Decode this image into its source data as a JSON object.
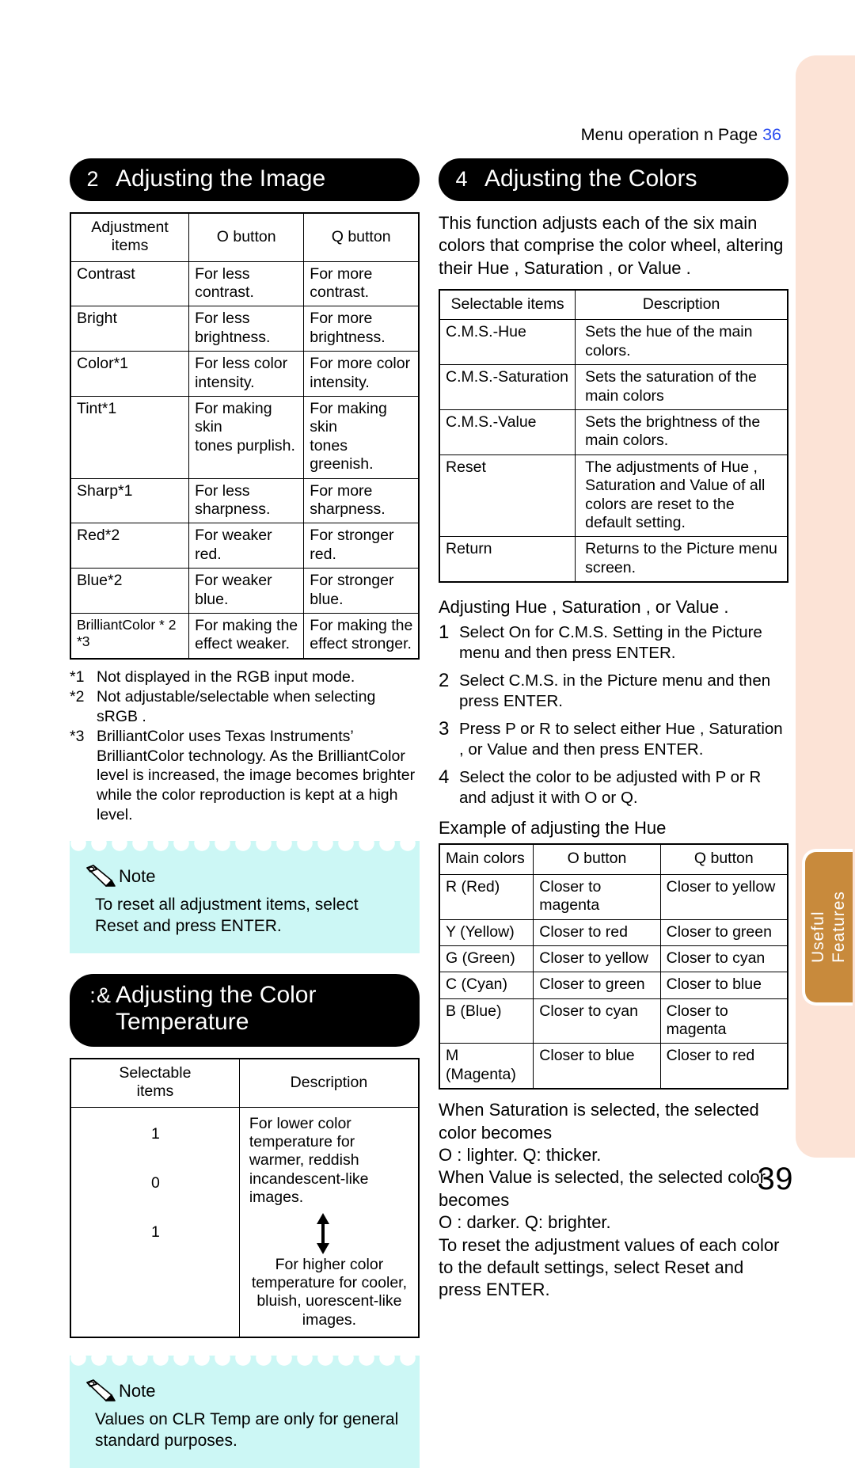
{
  "running_header": {
    "text": "Menu operation n  Page ",
    "page_ref": "36"
  },
  "page_number": "39",
  "side_tab": {
    "label": "Useful\nFeatures"
  },
  "section_image": {
    "number": "2",
    "title": "Adjusting the Image",
    "table": {
      "headers": [
        "Adjustment\nitems",
        "O  button",
        "Q  button"
      ],
      "rows": [
        {
          "item": "Contrast",
          "o": "For less\ncontrast.",
          "q": "For more\ncontrast."
        },
        {
          "item": "Bright",
          "o": "For less\nbrightness.",
          "q": "For more\nbrightness."
        },
        {
          "item": "Color*1",
          "o": "For less color\nintensity.",
          "q": "For more color\nintensity."
        },
        {
          "item": "Tint*1",
          "o": "For making skin\ntones purplish.",
          "q": "For making skin\ntones greenish."
        },
        {
          "item": "Sharp*1",
          "o": "For less\nsharpness.",
          "q": "For more\nsharpness."
        },
        {
          "item": "Red*2",
          "o": "For weaker red.",
          "q": "For stronger\nred."
        },
        {
          "item": "Blue*2",
          "o": "For weaker\nblue.",
          "q": "For stronger\nblue."
        },
        {
          "item": "BrilliantColor * 2 *3",
          "o": "For making the\neffect weaker.",
          "q": "For making the\neffect stronger."
        }
      ]
    },
    "footnotes": [
      {
        "mark": "*1",
        "text": "Not displayed in the RGB input mode."
      },
      {
        "mark": "*2",
        "text": "Not adjustable/selectable when selecting  sRGB ."
      },
      {
        "mark": "*3",
        "text": "BrilliantColor  uses Texas Instruments’ BrilliantColor  technology. As the BrilliantColor level is increased, the image becomes brighter while the color reproduction is kept at a high level."
      }
    ],
    "note": {
      "title": "Note",
      "body": "To reset all adjustment items, select  Reset  and press ENTER."
    }
  },
  "section_temperature": {
    "number_glyphs": [
      ":",
      "&"
    ],
    "title": "Adjusting the Color\nTemperature",
    "table": {
      "headers": [
        "Selectable\nitems",
        "Description"
      ],
      "rows": [
        {
          "value": "1",
          "desc": "For lower color temperature for warmer, reddish incandescent-like images."
        },
        {
          "value": "0",
          "desc": ""
        },
        {
          "value": "1",
          "desc": "For higher color temperature for cooler, bluish,  uorescent-like images."
        }
      ]
    },
    "note": {
      "title": "Note",
      "body": "Values on  CLR Temp  are only for general standard purposes."
    }
  },
  "section_colors": {
    "number": "4",
    "title": "Adjusting the Colors",
    "intro": "This function adjusts each of the six main colors that comprise the color wheel, altering their  Hue ,  Saturation , or  Value .",
    "table": {
      "headers": [
        "Selectable items",
        "Description"
      ],
      "rows": [
        {
          "item": "C.M.S.-Hue",
          "desc": "Sets the hue of the main colors."
        },
        {
          "item": "C.M.S.-Saturation",
          "desc": "Sets the saturation of the main colors"
        },
        {
          "item": "C.M.S.-Value",
          "desc": "Sets the brightness of the main colors."
        },
        {
          "item": "Reset",
          "desc": "The adjustments of  Hue ,  Saturation  and  Value  of all colors are reset to the default setting."
        },
        {
          "item": "Return",
          "desc": "Returns to the  Picture  menu screen."
        }
      ]
    },
    "procedure_title": "Adjusting  Hue ,  Saturation , or  Value .",
    "steps": [
      {
        "n": "1",
        "text": "Select  On  for  C.M.S. Setting  in the  Picture  menu and then press ENTER."
      },
      {
        "n": "2",
        "text": "Select  C.M.S.  in the  Picture  menu and then press ENTER."
      },
      {
        "n": "3",
        "text": "Press P  or R  to select either  Hue ,  Saturation , or  Value  and then press ENTER."
      },
      {
        "n": "4",
        "text": "Select the color to be adjusted with P  or R  and adjust it with O  or Q."
      }
    ],
    "example_title": "Example of adjusting the  Hue",
    "example_table": {
      "headers": [
        "Main colors",
        "O  button",
        "Q  button"
      ],
      "rows": [
        {
          "color": "R (Red)",
          "o": "Closer to magenta",
          "q": "Closer to yellow"
        },
        {
          "color": "Y (Yellow)",
          "o": "Closer to red",
          "q": "Closer to green"
        },
        {
          "color": "G (Green)",
          "o": "Closer to yellow",
          "q": "Closer to cyan"
        },
        {
          "color": "C (Cyan)",
          "o": "Closer to green",
          "q": "Closer to blue"
        },
        {
          "color": "B (Blue)",
          "o": "Closer to cyan",
          "q": "Closer to magenta"
        },
        {
          "color": "M (Magenta)",
          "o": "Closer to blue",
          "q": "Closer to red"
        }
      ]
    },
    "closing_text": "When  Saturation  is selected, the selected color becomes\nO : lighter.  Q: thicker.\nWhen  Value  is selected, the selected color becomes\nO : darker.  Q: brighter.\nTo reset the adjustment values of each color to the default settings, select  Reset  and press ENTER."
  },
  "colors": {
    "heading_bg": "#000000",
    "note_bg": "#ccf7f5",
    "edge_band": "#fce3d6",
    "edge_tab": "#c88a3c",
    "page_ref_blue": "#2b4df0"
  }
}
